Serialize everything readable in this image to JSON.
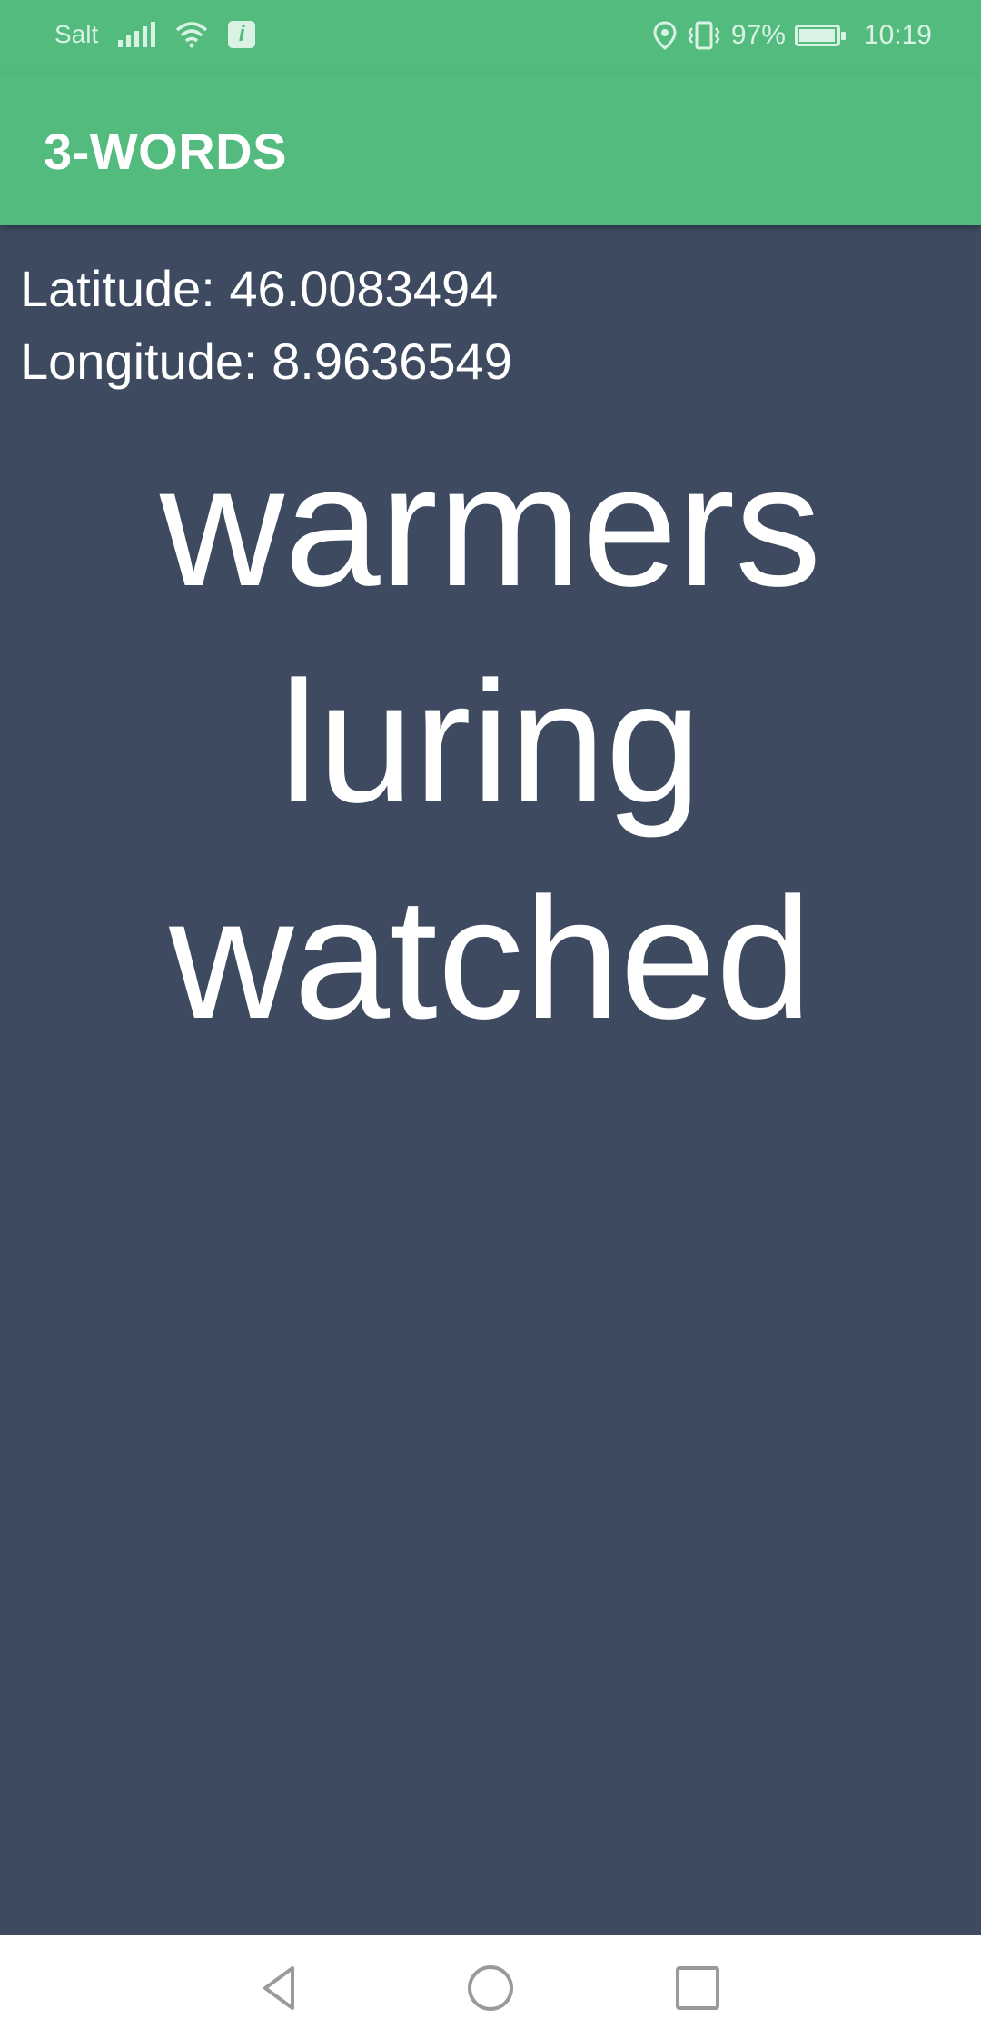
{
  "status_bar": {
    "carrier": "Salt",
    "battery_percent": "97%",
    "battery_level": 0.97,
    "time": "10:19",
    "icons": [
      "signal-icon",
      "wifi-icon",
      "info-icon",
      "location-icon",
      "vibrate-icon",
      "battery-icon"
    ]
  },
  "app_bar": {
    "title": "3-WORDS"
  },
  "location": {
    "latitude_text": "Latitude: 46.0083494",
    "longitude_text": "Longitude: 8.9636549"
  },
  "words": [
    "warmers",
    "luring",
    "watched"
  ],
  "nav_bar": {
    "icons": [
      "back-icon",
      "home-icon",
      "recents-icon"
    ]
  },
  "colors": {
    "accent": "#54bb7f",
    "background": "#3e4a5f",
    "text": "#ffffff"
  }
}
